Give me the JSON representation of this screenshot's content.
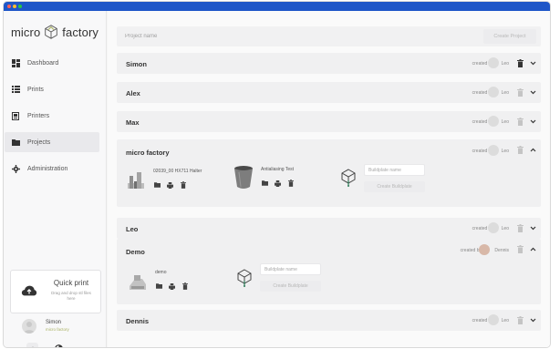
{
  "app": {
    "logo_left": "micro",
    "logo_right": "factory"
  },
  "sidebar": {
    "items": [
      {
        "label": "Dashboard",
        "icon": "dashboard-icon"
      },
      {
        "label": "Prints",
        "icon": "list-icon"
      },
      {
        "label": "Printers",
        "icon": "printer-icon"
      },
      {
        "label": "Projects",
        "icon": "folder-icon",
        "active": true
      },
      {
        "label": "Administration",
        "icon": "gear-icon"
      }
    ],
    "quickprint": {
      "title": "Quick print",
      "subtitle": "Drag and drop stl files here"
    },
    "user": {
      "name": "Simon",
      "org": "micro factory"
    }
  },
  "header": {
    "project_placeholder": "Project name",
    "create_label": "Create Project"
  },
  "projects": [
    {
      "name": "Simon",
      "created_by": "created by",
      "creator": "Leo",
      "expanded": false
    },
    {
      "name": "Alex",
      "created_by": "created by",
      "creator": "Leo",
      "expanded": false
    },
    {
      "name": "Max",
      "created_by": "created by",
      "creator": "Leo",
      "expanded": false
    },
    {
      "name": "micro factory",
      "created_by": "created by",
      "creator": "Leo",
      "expanded": true,
      "prints": [
        {
          "name": "02039_00 HX711 Halter"
        },
        {
          "name": "Antialiasing Test"
        }
      ],
      "buildplate": {
        "placeholder": "Buildplate name",
        "button": "Create Buildplate"
      }
    },
    {
      "name": "Leo",
      "created_by": "created by",
      "creator": "Leo",
      "expanded": false
    },
    {
      "name": "Demo",
      "created_by": "created by",
      "creator": "Dennis",
      "expanded": true,
      "prints": [
        {
          "name": "demo"
        }
      ],
      "buildplate": {
        "placeholder": "Buildplate name",
        "button": "Create Buildplate"
      }
    },
    {
      "name": "Dennis",
      "created_by": "created by",
      "creator": "Leo",
      "expanded": false
    }
  ],
  "colors": {
    "titlebar": "#1e56c8",
    "accent": "#a8b060"
  }
}
